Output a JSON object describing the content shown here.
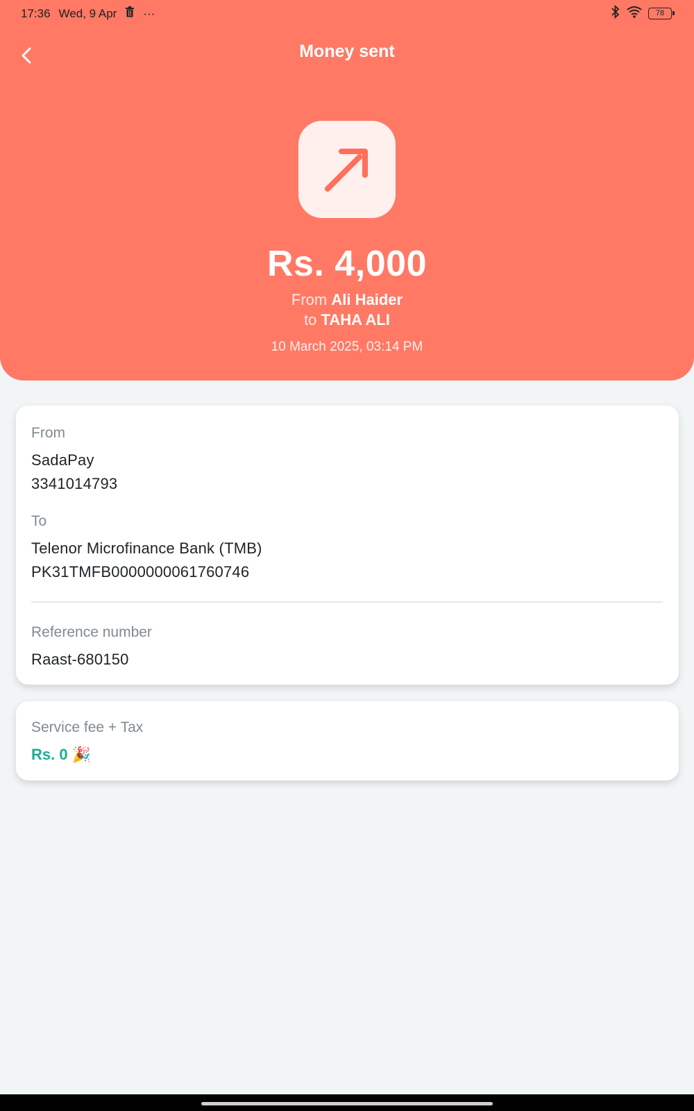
{
  "status_bar": {
    "time": "17:36",
    "date": "Wed, 9 Apr",
    "more": "···",
    "battery": "78"
  },
  "header": {
    "title": "Money sent",
    "amount": "Rs. 4,000",
    "from_prefix": "From",
    "from_name": "Ali Haider",
    "to_prefix": "to",
    "to_name": "TAHA ALI",
    "datetime": "10 March 2025, 03:14 PM",
    "icon": "arrow-up-right-icon"
  },
  "details": {
    "from_label": "From",
    "from_provider": "SadaPay",
    "from_account": "3341014793",
    "to_label": "To",
    "to_bank": "Telenor Microfinance Bank (TMB)",
    "to_iban": "PK31TMFB0000000061760746",
    "reference_label": "Reference number",
    "reference_value": "Raast-680150"
  },
  "fee": {
    "label": "Service fee + Tax",
    "value": "Rs. 0",
    "emoji": "🎉"
  },
  "colors": {
    "header_bg": "#ff7965",
    "fee_green": "#1aaf93",
    "page_bg": "#f2f5f6"
  }
}
